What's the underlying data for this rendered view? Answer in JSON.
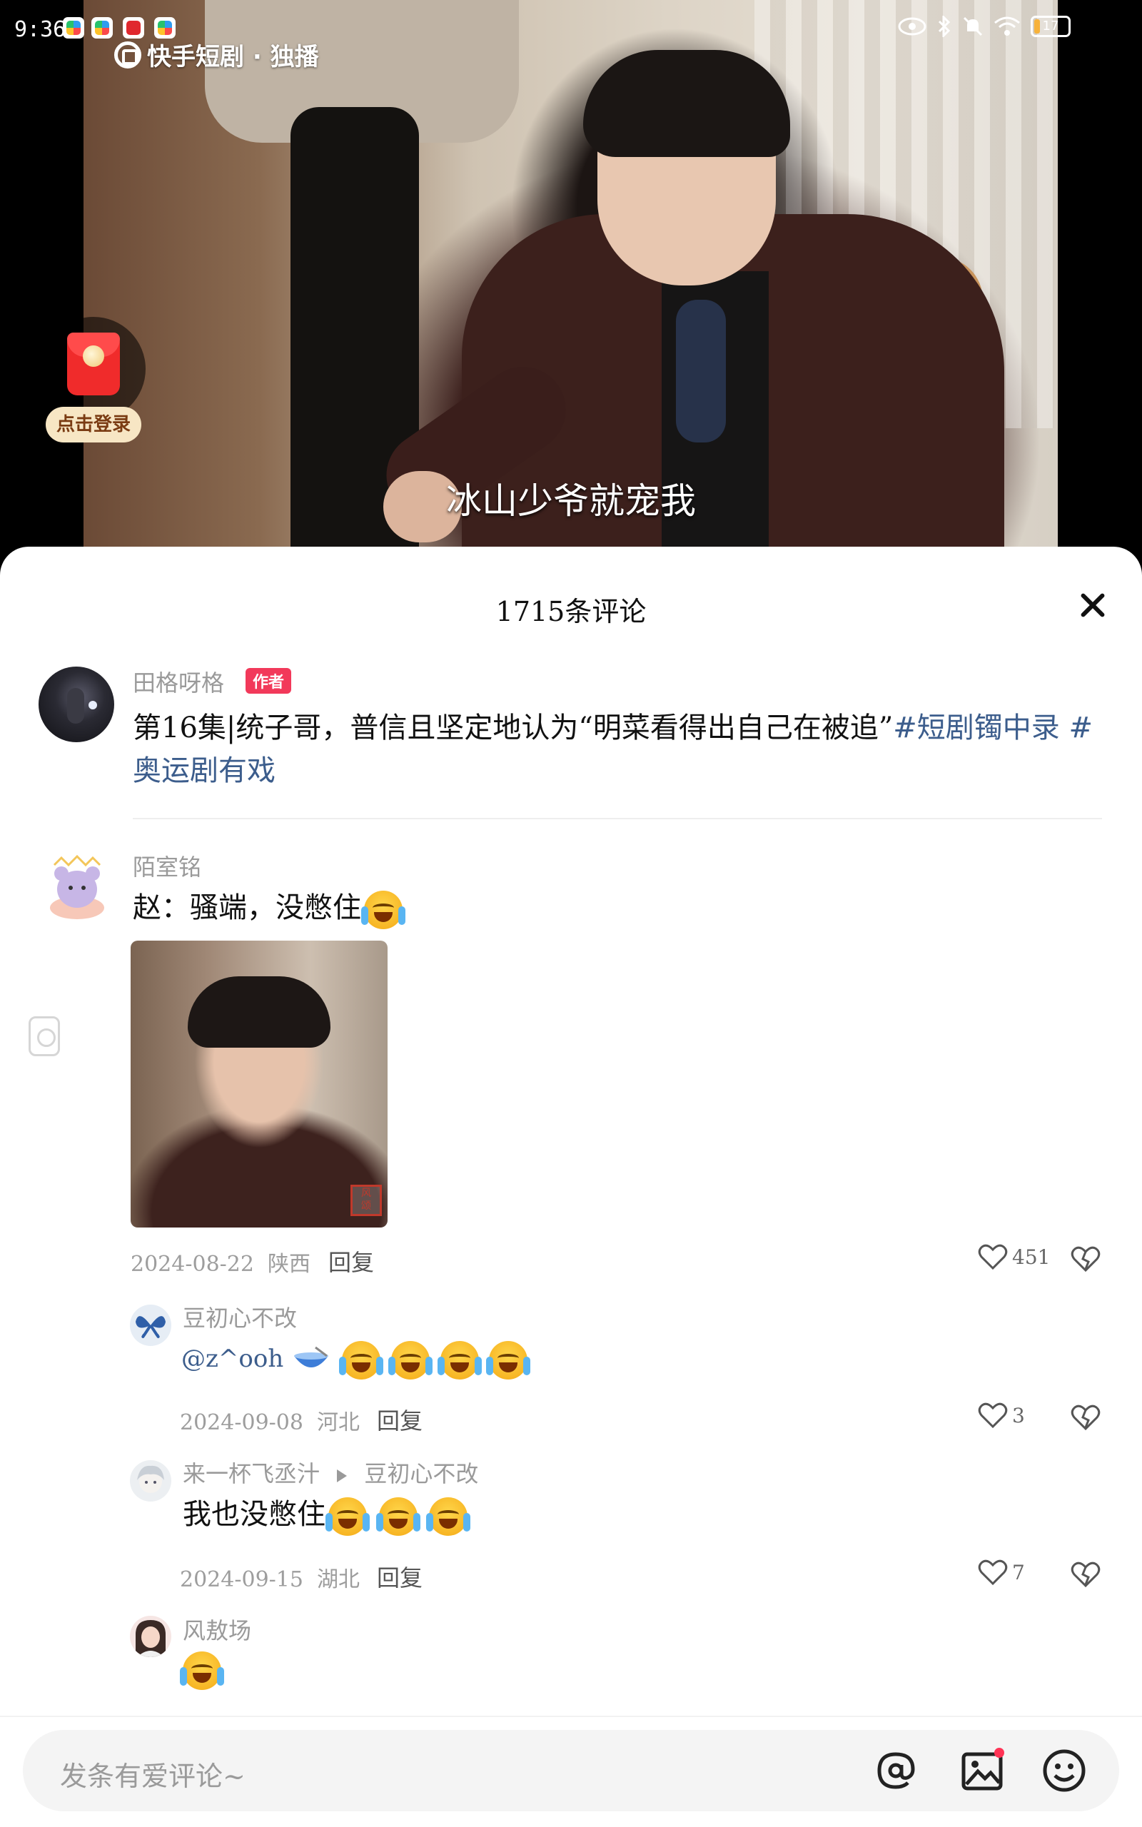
{
  "status_bar": {
    "time": "9:36",
    "battery": "17"
  },
  "video": {
    "brand": "快手短剧 · 独播",
    "subtitle": "冰山少爷就宠我",
    "login_label": "点击登录"
  },
  "sheet": {
    "title": "1715条评论",
    "author_post": {
      "user": "田格呀格",
      "badge": "作者",
      "text": "第16集|统子哥，普信且坚定地认为“明菜看得出自己在被追”",
      "tag1": "#短剧镯中录",
      "tag2": "#奥运剧有戏"
    },
    "comments": [
      {
        "user": "陌室铭",
        "text": "赵：骚端，没憋住",
        "date": "2024-08-22",
        "region": "陕西",
        "reply": "回复",
        "likes": "451"
      },
      {
        "user": "豆初心不改",
        "text": "@z^ooh",
        "date": "2024-09-08",
        "region": "河北",
        "reply": "回复",
        "likes": "3"
      },
      {
        "user": "来一杯飞丞汁",
        "reply_to": "豆初心不改",
        "text": "我也没憋住",
        "date": "2024-09-15",
        "region": "湖北",
        "reply": "回复",
        "likes": "7"
      },
      {
        "user": "风敖场",
        "text": ""
      }
    ]
  },
  "input": {
    "placeholder": "发条有爱评论~"
  },
  "colors": {
    "accent_tag": "#3c5d8c",
    "author_badge": "#f2395a",
    "red_packet": "#f02b2b"
  }
}
